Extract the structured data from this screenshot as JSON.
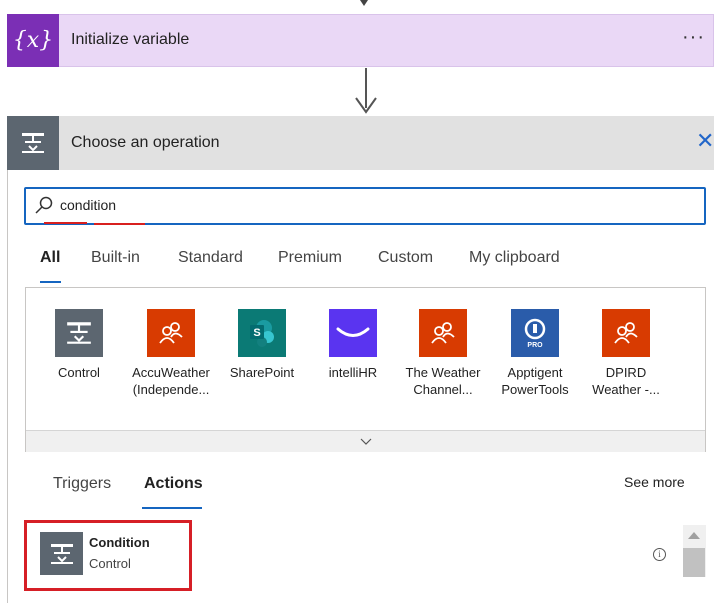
{
  "init_card": {
    "title": "Initialize variable",
    "icon": "variable-icon",
    "more": "···",
    "color": "#7b2fb5"
  },
  "op_panel": {
    "title": "Choose an operation",
    "icon": "control-icon",
    "close": "✕"
  },
  "search": {
    "value": "condition",
    "placeholder": "Search connectors and actions"
  },
  "tabs": [
    {
      "label": "All",
      "active": true
    },
    {
      "label": "Built-in"
    },
    {
      "label": "Standard"
    },
    {
      "label": "Premium"
    },
    {
      "label": "Custom"
    },
    {
      "label": "My clipboard"
    }
  ],
  "connectors": [
    {
      "label": "Control",
      "color": "#5c6670",
      "icon": "control-icon"
    },
    {
      "label": "AccuWeather (Independe...",
      "color": "#d83b01",
      "icon": "people-icon"
    },
    {
      "label": "SharePoint",
      "color": "#0b7a75",
      "icon": "sharepoint-icon"
    },
    {
      "label": "intelliHR",
      "color": "#5a34f0",
      "icon": "smile-icon"
    },
    {
      "label": "The Weather Channel...",
      "color": "#d83b01",
      "icon": "people-icon"
    },
    {
      "label": "Apptigent PowerTools",
      "color": "#2a5caa",
      "icon": "pro-badge-icon"
    },
    {
      "label": "DPIRD Weather -...",
      "color": "#d83b01",
      "icon": "people-icon"
    }
  ],
  "subtabs": [
    {
      "label": "Triggers"
    },
    {
      "label": "Actions",
      "active": true
    }
  ],
  "see_more": "See more",
  "result": {
    "name": "Condition",
    "connector": "Control",
    "icon": "control-icon",
    "info": "i"
  }
}
